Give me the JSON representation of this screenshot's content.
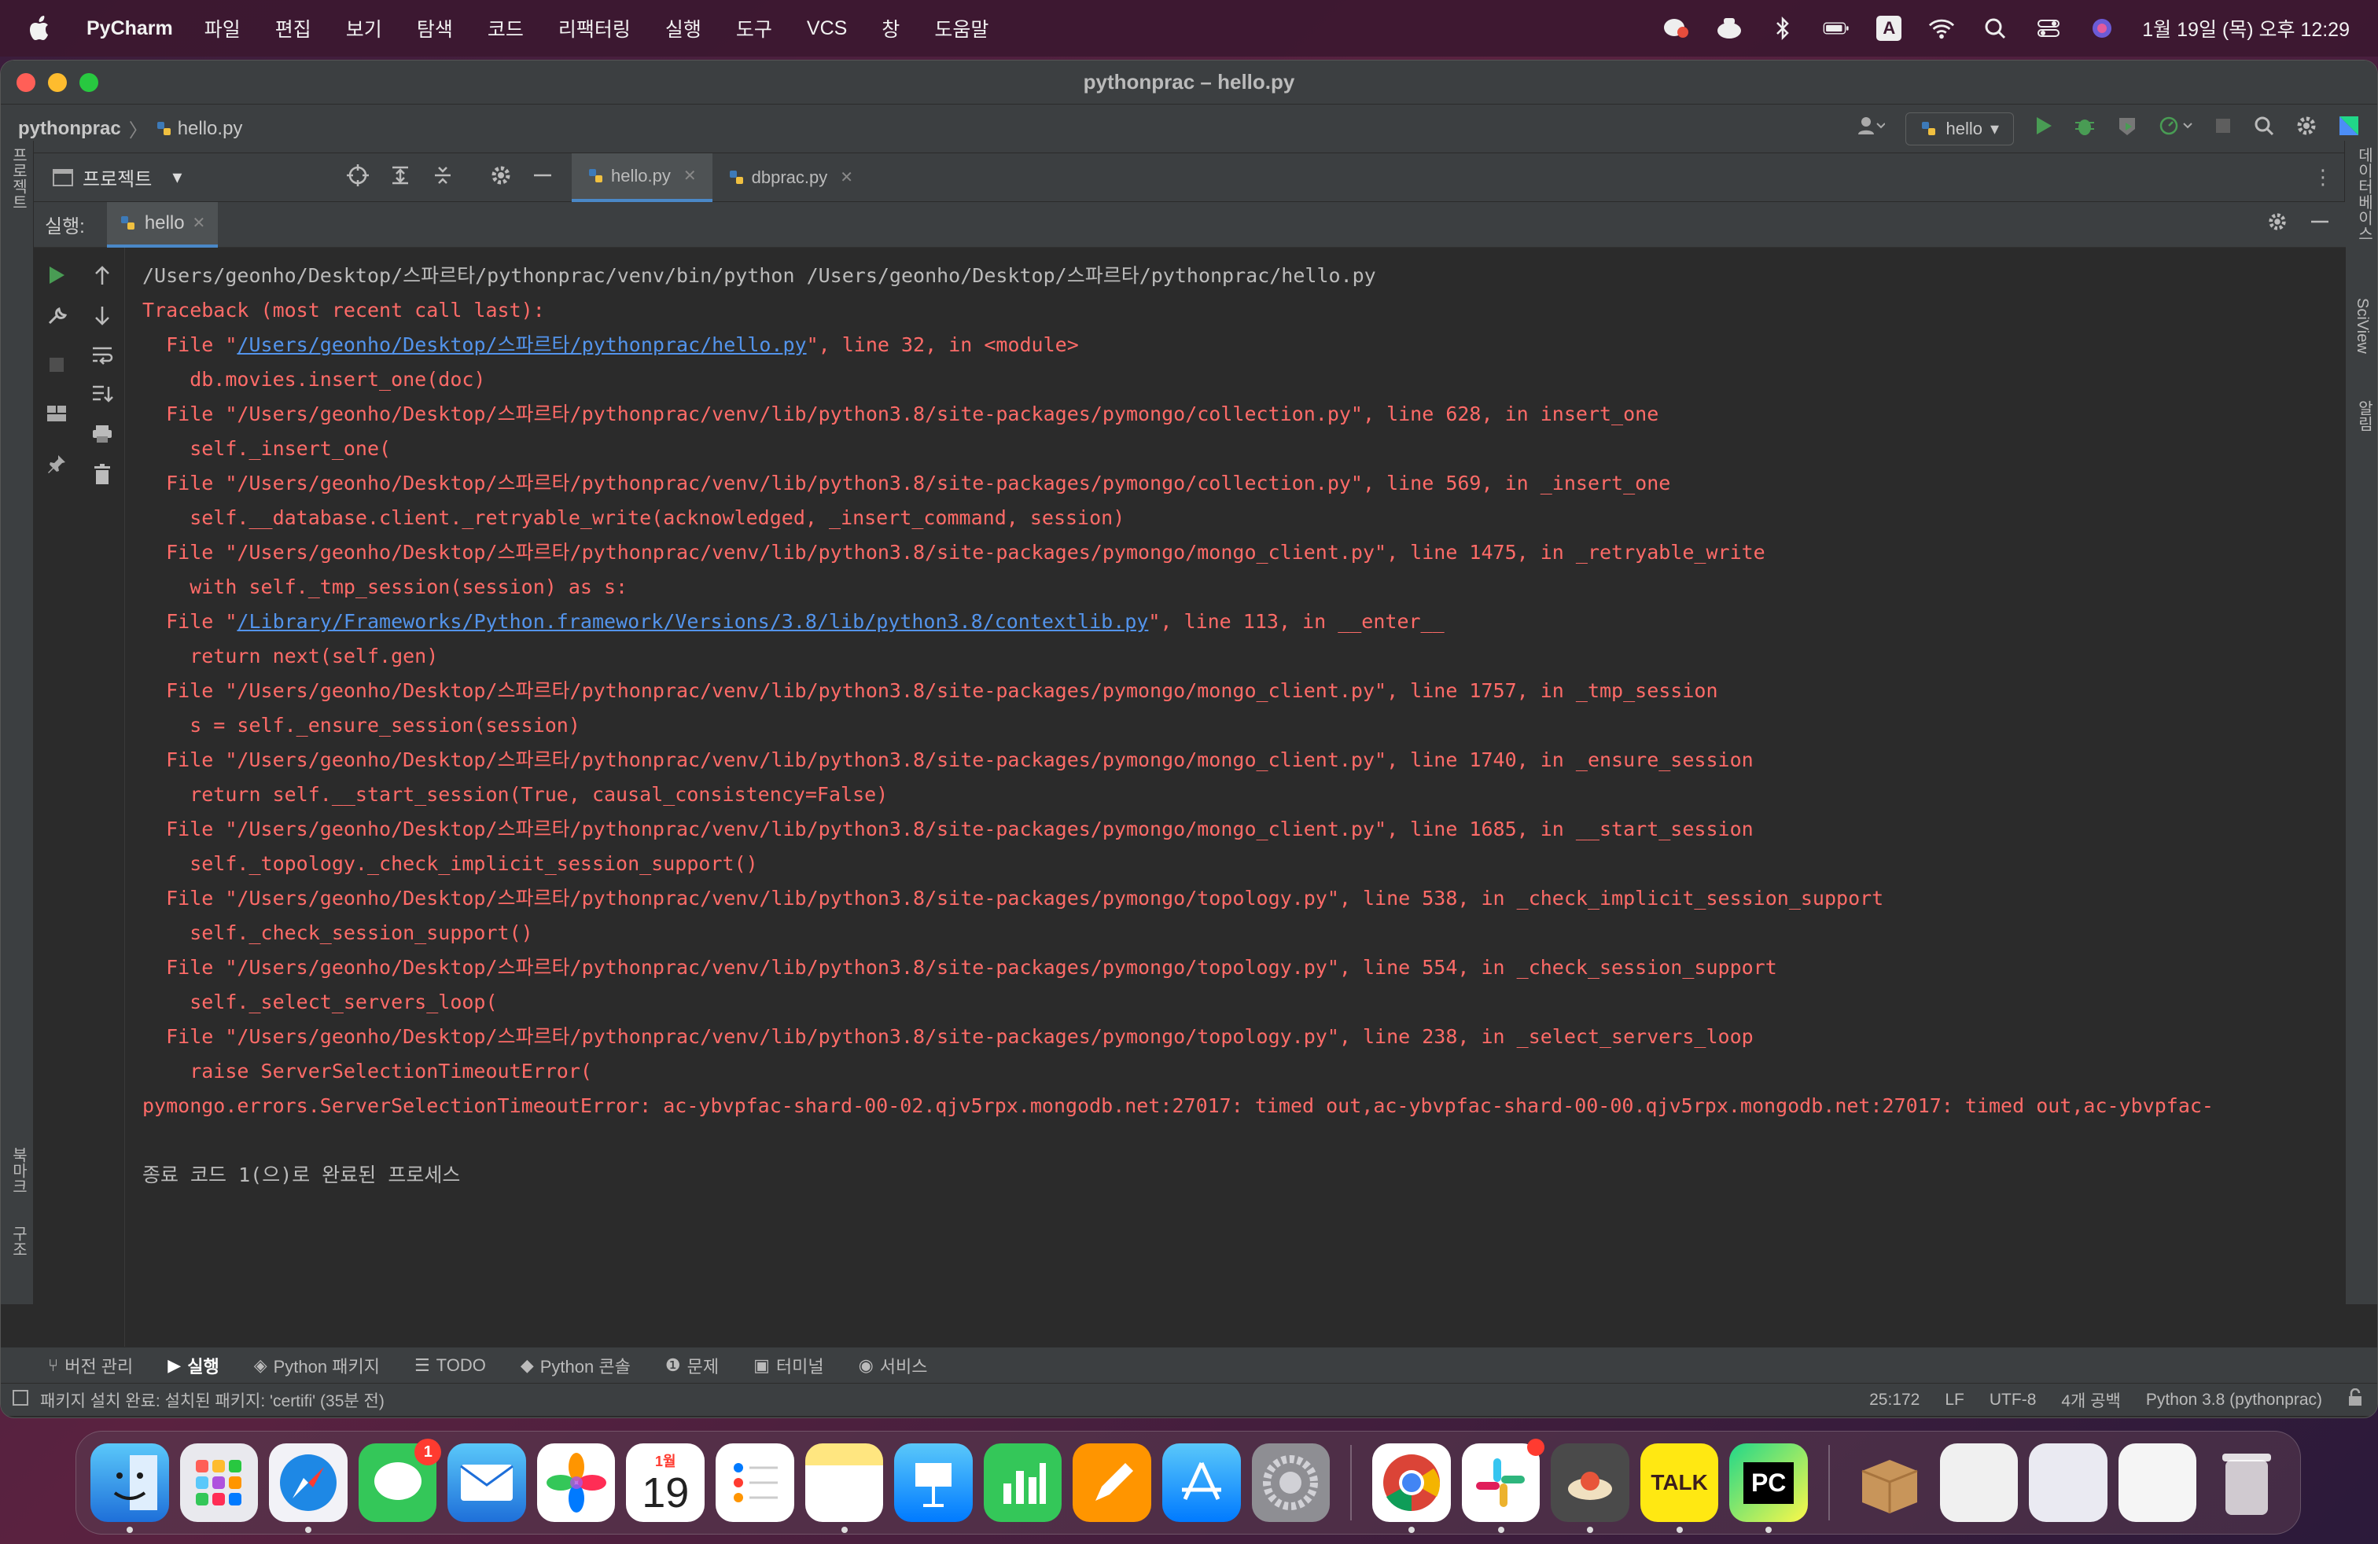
{
  "menubar": {
    "app_name": "PyCharm",
    "items": [
      "파일",
      "편집",
      "보기",
      "탐색",
      "코드",
      "리팩터링",
      "실행",
      "도구",
      "VCS",
      "창",
      "도움말"
    ],
    "clock": "1월 19일 (목) 오후 12:29",
    "input_source": "A"
  },
  "window": {
    "title": "pythonprac – hello.py"
  },
  "navbar": {
    "project": "pythonprac",
    "file": "hello.py",
    "run_config": "hello"
  },
  "toolrow": {
    "project_label": "프로젝트",
    "tabs": [
      {
        "label": "hello.py"
      },
      {
        "label": "dbprac.py"
      }
    ]
  },
  "run": {
    "label": "실행:",
    "tab": "hello"
  },
  "console": {
    "lines": [
      {
        "t": "cmd",
        "text": "/Users/geonho/Desktop/스파르타/pythonprac/venv/bin/python /Users/geonho/Desktop/스파르타/pythonprac/hello.py"
      },
      {
        "t": "err",
        "text": "Traceback (most recent call last):"
      },
      {
        "t": "errlink",
        "pre": "  File \"",
        "link": "/Users/geonho/Desktop/스파르타/pythonprac/hello.py",
        "post": "\", line 32, in <module>"
      },
      {
        "t": "err",
        "text": "    db.movies.insert_one(doc)"
      },
      {
        "t": "err",
        "text": "  File \"/Users/geonho/Desktop/스파르타/pythonprac/venv/lib/python3.8/site-packages/pymongo/collection.py\", line 628, in insert_one"
      },
      {
        "t": "err",
        "text": "    self._insert_one("
      },
      {
        "t": "err",
        "text": "  File \"/Users/geonho/Desktop/스파르타/pythonprac/venv/lib/python3.8/site-packages/pymongo/collection.py\", line 569, in _insert_one"
      },
      {
        "t": "err",
        "text": "    self.__database.client._retryable_write(acknowledged, _insert_command, session)"
      },
      {
        "t": "err",
        "text": "  File \"/Users/geonho/Desktop/스파르타/pythonprac/venv/lib/python3.8/site-packages/pymongo/mongo_client.py\", line 1475, in _retryable_write"
      },
      {
        "t": "err",
        "text": "    with self._tmp_session(session) as s:"
      },
      {
        "t": "errlink",
        "pre": "  File \"",
        "link": "/Library/Frameworks/Python.framework/Versions/3.8/lib/python3.8/contextlib.py",
        "post": "\", line 113, in __enter__"
      },
      {
        "t": "err",
        "text": "    return next(self.gen)"
      },
      {
        "t": "err",
        "text": "  File \"/Users/geonho/Desktop/스파르타/pythonprac/venv/lib/python3.8/site-packages/pymongo/mongo_client.py\", line 1757, in _tmp_session"
      },
      {
        "t": "err",
        "text": "    s = self._ensure_session(session)"
      },
      {
        "t": "err",
        "text": "  File \"/Users/geonho/Desktop/스파르타/pythonprac/venv/lib/python3.8/site-packages/pymongo/mongo_client.py\", line 1740, in _ensure_session"
      },
      {
        "t": "err",
        "text": "    return self.__start_session(True, causal_consistency=False)"
      },
      {
        "t": "err",
        "text": "  File \"/Users/geonho/Desktop/스파르타/pythonprac/venv/lib/python3.8/site-packages/pymongo/mongo_client.py\", line 1685, in __start_session"
      },
      {
        "t": "err",
        "text": "    self._topology._check_implicit_session_support()"
      },
      {
        "t": "err",
        "text": "  File \"/Users/geonho/Desktop/스파르타/pythonprac/venv/lib/python3.8/site-packages/pymongo/topology.py\", line 538, in _check_implicit_session_support"
      },
      {
        "t": "err",
        "text": "    self._check_session_support()"
      },
      {
        "t": "err",
        "text": "  File \"/Users/geonho/Desktop/스파르타/pythonprac/venv/lib/python3.8/site-packages/pymongo/topology.py\", line 554, in _check_session_support"
      },
      {
        "t": "err",
        "text": "    self._select_servers_loop("
      },
      {
        "t": "err",
        "text": "  File \"/Users/geonho/Desktop/스파르타/pythonprac/venv/lib/python3.8/site-packages/pymongo/topology.py\", line 238, in _select_servers_loop"
      },
      {
        "t": "err",
        "text": "    raise ServerSelectionTimeoutError("
      },
      {
        "t": "err",
        "text": "pymongo.errors.ServerSelectionTimeoutError: ac-ybvpfac-shard-00-02.qjv5rpx.mongodb.net:27017: timed out,ac-ybvpfac-shard-00-00.qjv5rpx.mongodb.net:27017: timed out,ac-ybvpfac-"
      },
      {
        "t": "blank",
        "text": ""
      },
      {
        "t": "done",
        "text": "종료 코드 1(으)로 완료된 프로세스"
      }
    ]
  },
  "stripes": {
    "left_top": "프로젝트",
    "left_bookmarks": "북마크",
    "left_structure": "구조",
    "right_database": "데이터베이스",
    "right_sciview": "SciView",
    "right_notifications": "알림"
  },
  "bottombar": {
    "items": [
      "버전 관리",
      "실행",
      "Python 패키지",
      "TODO",
      "Python 콘솔",
      "문제",
      "터미널",
      "서비스"
    ]
  },
  "statusbar": {
    "message": "패키지 설치 완료: 설치된 패키지: 'certifi' (35분 전)",
    "position": "25:172",
    "line_sep": "LF",
    "encoding": "UTF-8",
    "indent": "4개 공백",
    "interpreter": "Python 3.8 (pythonprac)"
  },
  "dock": {
    "calendar_month": "1월",
    "calendar_day": "19",
    "messages_badge": "1",
    "talk_label": "TALK",
    "pycharm_label": "PC"
  },
  "colors": {
    "console_bg": "#2b2b2b",
    "error_text": "#ff6b68",
    "link_text": "#5394ec",
    "panel_bg": "#3c3f41",
    "run_green": "#499c54"
  }
}
